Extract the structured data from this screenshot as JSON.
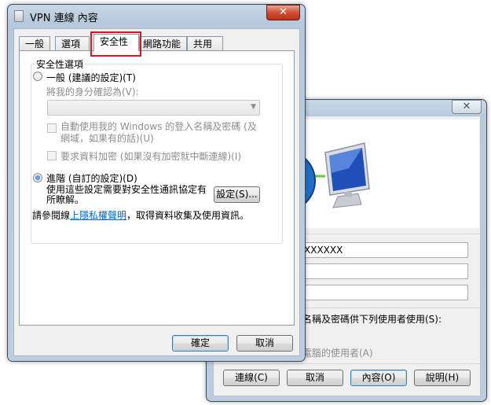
{
  "main_window": {
    "title": "VPN 連線 內容",
    "close_glyph": "✕",
    "tabs": [
      "一般",
      "選項",
      "安全性",
      "網路功能",
      "共用"
    ],
    "active_tab": "安全性",
    "group_label": "安全性選項",
    "radio_typical": "一般 (建議的設定)(T)",
    "verify_label": "將我的身分確認為(V):",
    "verify_value": "",
    "auto_logon": "自動使用我的 Windows 的登入名稱及密碼 (及網域，如果有的話)(U)",
    "require_encryption": "要求資料加密 (如果沒有加密就中斷連線)(I)",
    "radio_advanced": "進階 (自訂的設定)(D)",
    "advanced_desc": "使用這些設定需要對安全性通訊協定有所瞭解。",
    "settings_button": "設定(S)...",
    "privacy_prefix": "請參閱線",
    "privacy_link": "上隱私權聲明",
    "privacy_suffix": "，取得資料收集及使用資訊。",
    "ok_button": "確定",
    "cancel_button": "取消"
  },
  "back_window": {
    "close_glyph": "✕",
    "field1_value": "XXXXXX",
    "field2_value": "",
    "field3_value": "",
    "save_text": "名稱及密碼供下列使用者使用(S):",
    "option1_text": ")",
    "option2_text": "電腦的使用者(A)",
    "buttons": [
      "連線(C)",
      "取消",
      "內容(O)",
      "說明(H)"
    ]
  },
  "colors": {
    "highlight": "#e0141e",
    "link": "#0066cc",
    "network_line": "#66c83c"
  }
}
